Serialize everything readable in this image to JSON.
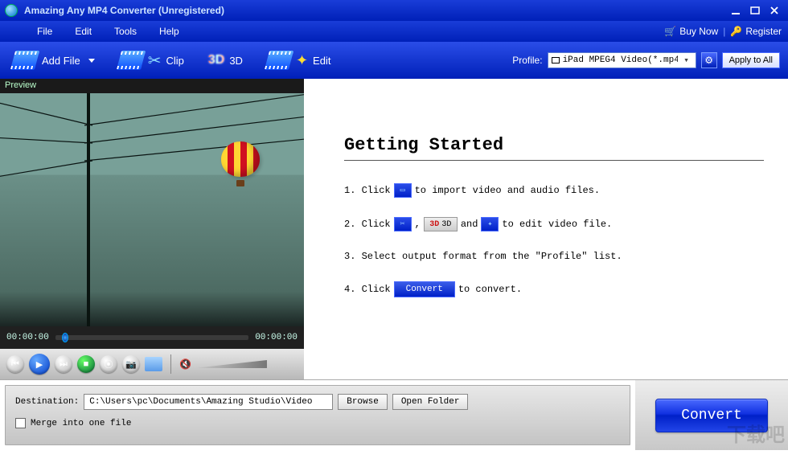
{
  "window": {
    "title": "Amazing Any MP4 Converter (Unregistered)"
  },
  "menu": {
    "file": "File",
    "edit": "Edit",
    "tools": "Tools",
    "help": "Help",
    "buy_now": "Buy Now",
    "register": "Register"
  },
  "toolbar": {
    "add_file": "Add File",
    "clip": "Clip",
    "three_d": "3D",
    "edit_btn": "Edit",
    "profile_label": "Profile:",
    "profile_value": "iPad MPEG4 Video(*.mp4)",
    "apply_all": "Apply to All"
  },
  "preview": {
    "header": "Preview",
    "time_start": "00:00:00",
    "time_end": "00:00:00"
  },
  "getting_started": {
    "heading": "Getting Started",
    "s1a": "1. Click",
    "s1b": "to import video and audio files.",
    "s2a": "2. Click",
    "s2b": ",",
    "s2c": "and",
    "s2d": "to edit video file.",
    "s2_3d": "3D",
    "s3": "3. Select output format from the \"Profile\" list.",
    "s4a": "4. Click",
    "s4_btn": "Convert",
    "s4b": "to convert."
  },
  "bottom": {
    "dest_label": "Destination:",
    "dest_value": "C:\\Users\\pc\\Documents\\Amazing Studio\\Video",
    "browse": "Browse",
    "open_folder": "Open Folder",
    "merge": "Merge into one file",
    "convert": "Convert"
  },
  "wm": "下载吧"
}
